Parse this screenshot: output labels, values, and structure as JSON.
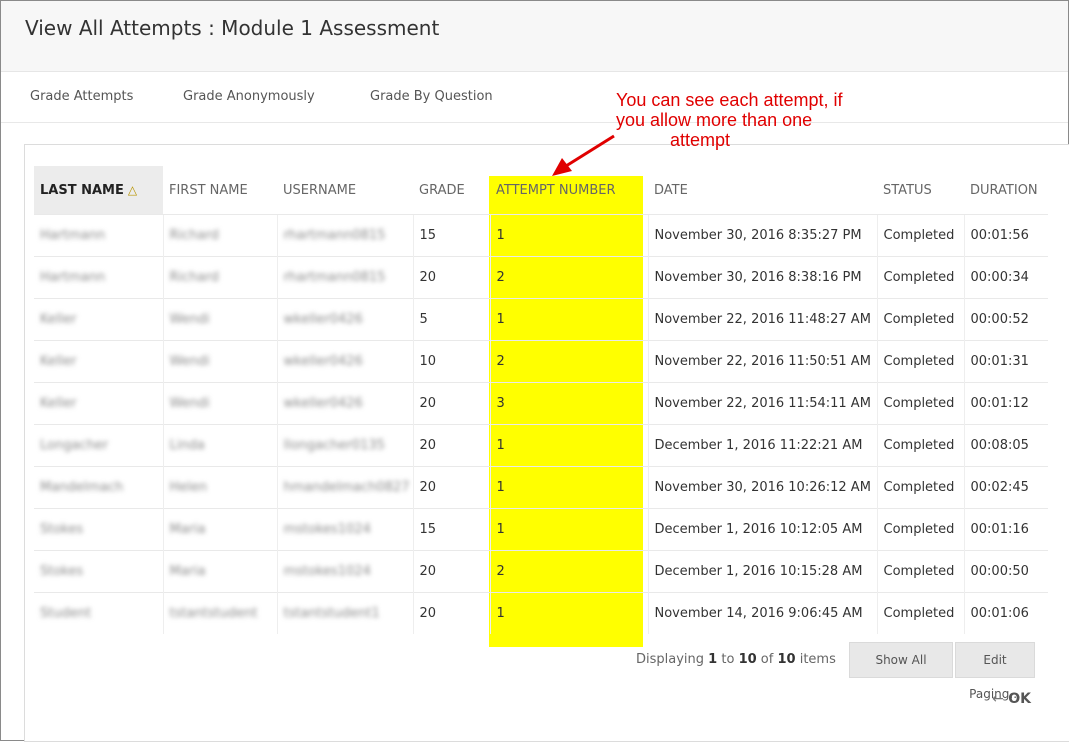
{
  "page": {
    "title": "View All Attempts : Module 1 Assessment"
  },
  "toolbar": {
    "grade_attempts": "Grade Attempts",
    "grade_anonymously": "Grade Anonymously",
    "grade_by_question": "Grade By Question"
  },
  "annotation": {
    "line1": "You can see each attempt, if",
    "line2": "you allow more than one",
    "line3": "attempt",
    "color": "#e00000"
  },
  "table": {
    "headers": {
      "last_name": "LAST NAME",
      "first_name": "FIRST NAME",
      "username": "USERNAME",
      "grade": "GRADE",
      "attempt_number": "ATTEMPT NUMBER",
      "date": "DATE",
      "status": "STATUS",
      "duration": "DURATION"
    },
    "sort_icon": "sort-ascending-icon",
    "highlight_color": "#ffff00",
    "rows": [
      {
        "last": "Hartmann",
        "first": "Richard",
        "user": "rhartmann0815",
        "grade": "15",
        "attempt": "1",
        "date": "November 30, 2016 8:35:27 PM",
        "status": "Completed",
        "duration": "00:01:56"
      },
      {
        "last": "Hartmann",
        "first": "Richard",
        "user": "rhartmann0815",
        "grade": "20",
        "attempt": "2",
        "date": "November 30, 2016 8:38:16 PM",
        "status": "Completed",
        "duration": "00:00:34"
      },
      {
        "last": "Keller",
        "first": "Wendi",
        "user": "wkeller0426",
        "grade": "5",
        "attempt": "1",
        "date": "November 22, 2016 11:48:27 AM",
        "status": "Completed",
        "duration": "00:00:52"
      },
      {
        "last": "Keller",
        "first": "Wendi",
        "user": "wkeller0426",
        "grade": "10",
        "attempt": "2",
        "date": "November 22, 2016 11:50:51 AM",
        "status": "Completed",
        "duration": "00:01:31"
      },
      {
        "last": "Keller",
        "first": "Wendi",
        "user": "wkeller0426",
        "grade": "20",
        "attempt": "3",
        "date": "November 22, 2016 11:54:11 AM",
        "status": "Completed",
        "duration": "00:01:12"
      },
      {
        "last": "Longacher",
        "first": "Linda",
        "user": "llongacher0135",
        "grade": "20",
        "attempt": "1",
        "date": "December 1, 2016 11:22:21 AM",
        "status": "Completed",
        "duration": "00:08:05"
      },
      {
        "last": "Mandelmach",
        "first": "Helen",
        "user": "hmandelmach0827",
        "grade": "20",
        "attempt": "1",
        "date": "November 30, 2016 10:26:12 AM",
        "status": "Completed",
        "duration": "00:02:45"
      },
      {
        "last": "Stokes",
        "first": "Maria",
        "user": "mstokes1024",
        "grade": "15",
        "attempt": "1",
        "date": "December 1, 2016 10:12:05 AM",
        "status": "Completed",
        "duration": "00:01:16"
      },
      {
        "last": "Stokes",
        "first": "Maria",
        "user": "mstokes1024",
        "grade": "20",
        "attempt": "2",
        "date": "December 1, 2016 10:15:28 AM",
        "status": "Completed",
        "duration": "00:00:50"
      },
      {
        "last": "Student",
        "first": "tstantstudent",
        "user": "tstantstudent1",
        "grade": "20",
        "attempt": "1",
        "date": "November 14, 2016 9:06:45 AM",
        "status": "Completed",
        "duration": "00:01:06"
      }
    ]
  },
  "footer": {
    "displaying": "Displaying",
    "from": "1",
    "to_word": "to",
    "to": "10",
    "of_word": "of",
    "total": "10",
    "items": "items",
    "show_all": "Show All",
    "edit_paging": "Edit Paging...",
    "ok_arrow": "←",
    "ok": "OK"
  }
}
